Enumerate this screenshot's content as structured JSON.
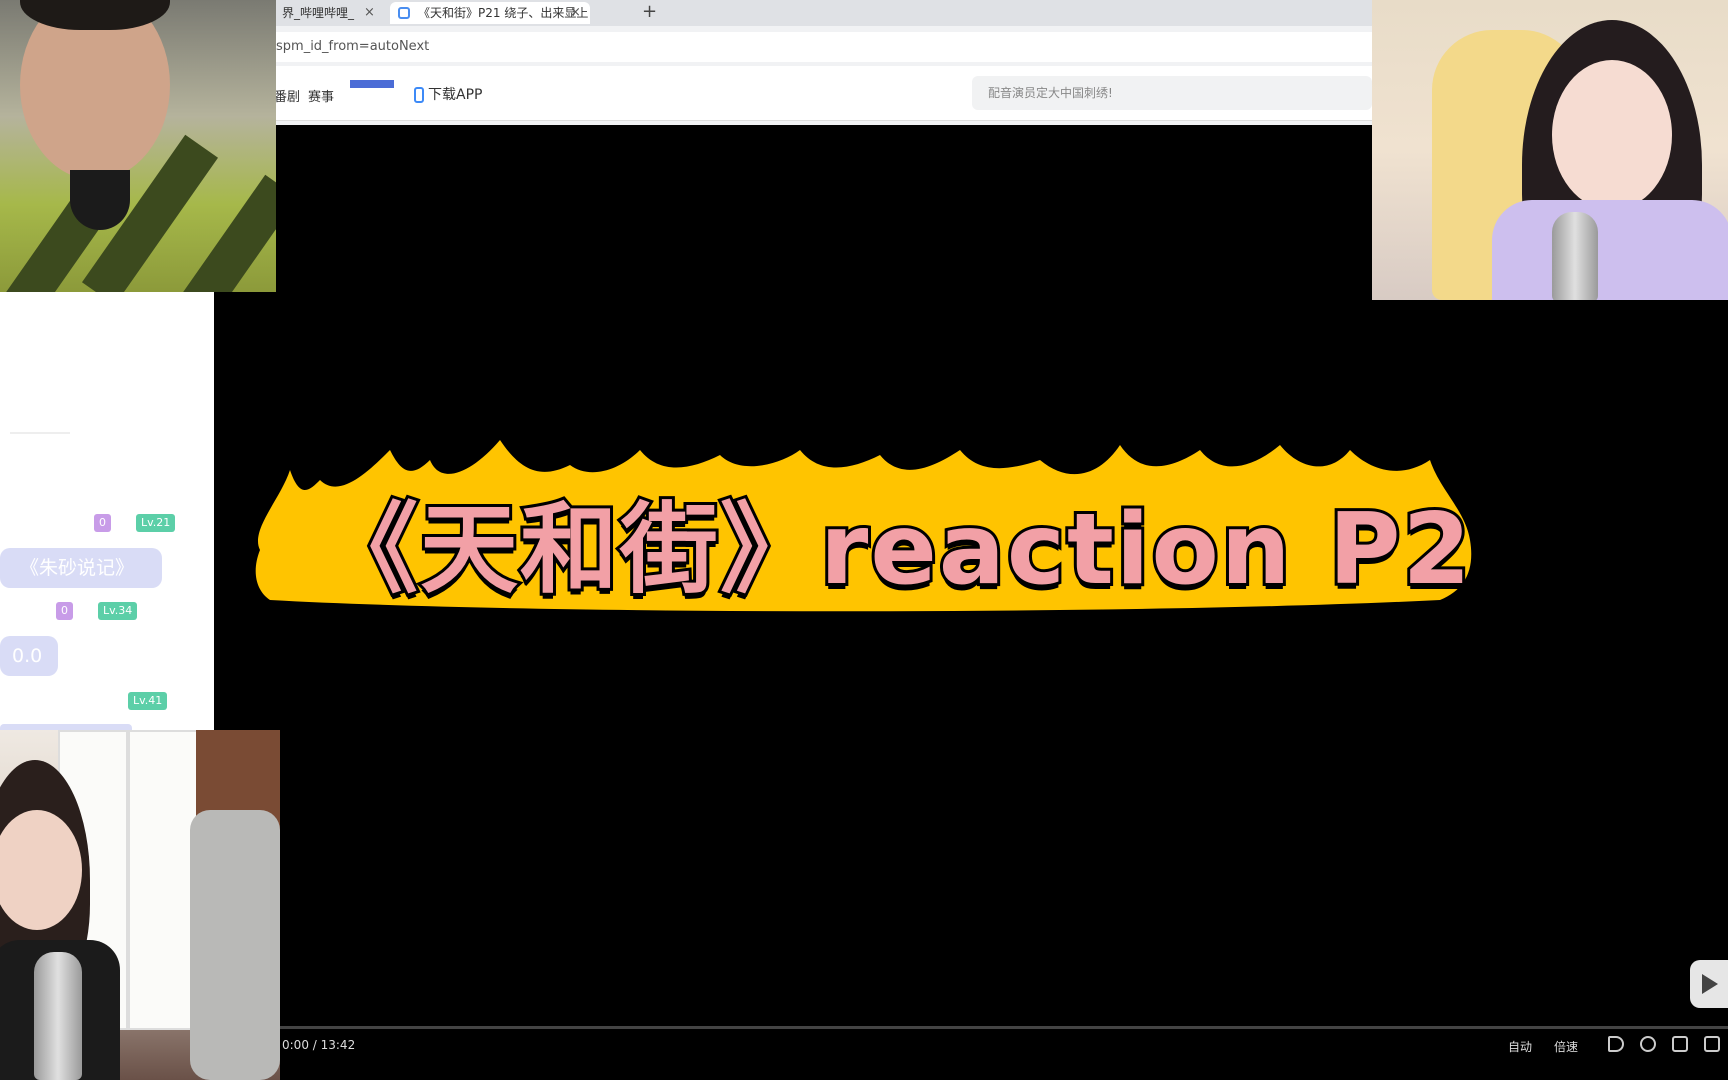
{
  "browser": {
    "tabs": [
      {
        "label": "界_哔哩哔哩_",
        "close": "×"
      },
      {
        "label": "《天和街》P21 绕子、出来显上",
        "close": "×"
      }
    ],
    "new_tab": "+",
    "url": "spm_id_from=autoNext",
    "nav": {
      "links": [
        "番剧",
        "赛事"
      ],
      "download_label": "下载APP",
      "search_placeholder": "配音演员定大中国刺绣!"
    }
  },
  "video": {
    "title": "《天和街》reaction P2",
    "time": "0:00 / 13:42",
    "controls": [
      "自动",
      "倍速"
    ]
  },
  "chat": {
    "messages": [
      {
        "badge1": "0",
        "badge2": "Lv.21",
        "text": "《朱砂说记》"
      },
      {
        "badge1": "0",
        "badge2": "Lv.34",
        "text": "0.0"
      },
      {
        "badge2": "Lv.41"
      }
    ]
  },
  "colors": {
    "banner": "#ffc400",
    "title_fill": "#f2a0a6",
    "chat_bubble": "#d9dcf6",
    "level_badge": "#5ccfa8",
    "medal_badge": "#c89ce8"
  }
}
